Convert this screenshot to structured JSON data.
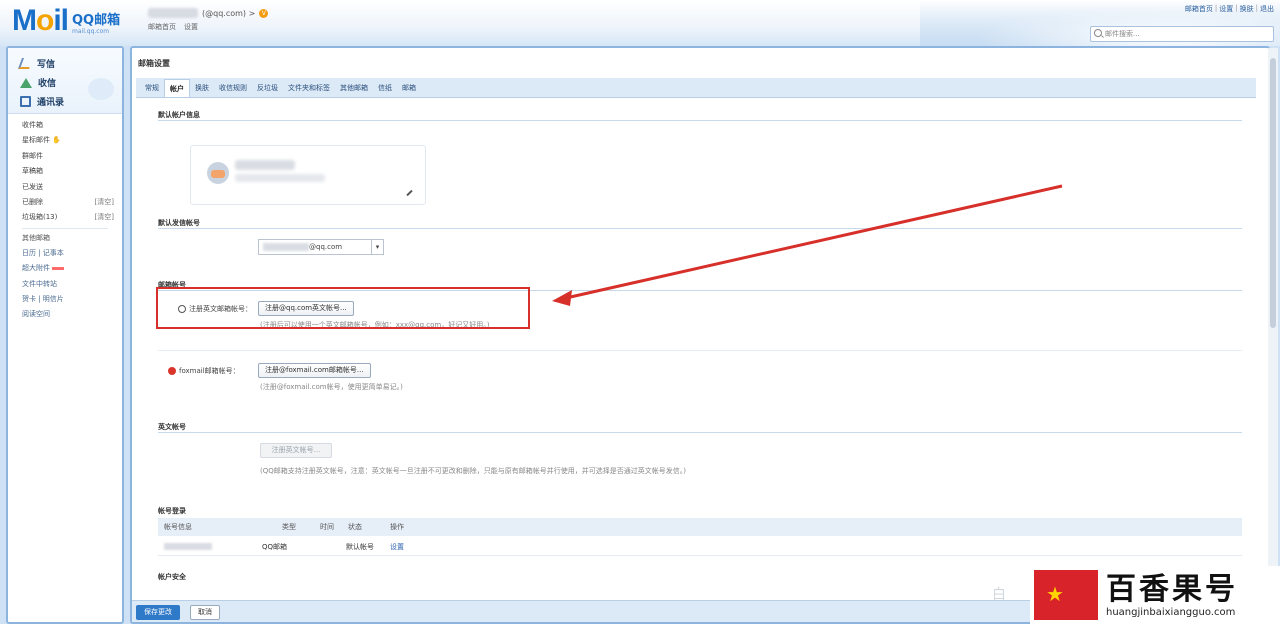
{
  "header": {
    "logo_main": "M",
    "logo_o": "o",
    "logo_tail": "il",
    "logo_cn": "QQ邮箱",
    "logo_sub": "mail.qq.com",
    "account_email": "(@qq.com) >",
    "vip": "V",
    "account_links": [
      "邮箱首页",
      "设置"
    ],
    "top_links": [
      "邮箱首页",
      "设置",
      "换肤",
      "退出"
    ],
    "search_placeholder": "邮件搜索..."
  },
  "sidebar": {
    "actions": [
      "写信",
      "收信",
      "通讯录"
    ],
    "folders": [
      {
        "label": "收件箱",
        "extra": ""
      },
      {
        "label": "星标邮件 ✋",
        "extra": ""
      },
      {
        "label": "群邮件",
        "extra": ""
      },
      {
        "label": "草稿箱",
        "extra": ""
      },
      {
        "label": "已发送",
        "extra": ""
      },
      {
        "label": "已删除",
        "extra": "[清空]"
      },
      {
        "label": "垃圾箱(13)",
        "extra": "[清空]"
      }
    ],
    "section_title": "其他邮箱",
    "subfolders": [
      "日历 | 记事本",
      "超大附件",
      "文件中转站",
      "贺卡 | 明信片",
      "阅读空间"
    ]
  },
  "panel": {
    "title": "邮箱设置",
    "tabs": [
      "常规",
      "帐户",
      "换肤",
      "收信规则",
      "反垃圾",
      "文件夹和标签",
      "其他邮箱",
      "信纸",
      "邮箱"
    ],
    "active_tab": "帐户",
    "sections": {
      "default_account": "默认帐户信息",
      "default_send": "默认发信帐号",
      "alias": "邮箱帐号",
      "english": "英文帐号",
      "login_history": "帐号登录",
      "security": "帐户安全"
    },
    "default_send_suffix": "@qq.com",
    "alias_qq_label": "注册英文邮箱帐号：",
    "alias_qq_button": "注册@qq.com英文帐号...",
    "alias_qq_hint": "(注册后可以使用一个英文邮箱帐号，例如：xxx@qq.com，好记又好用。)",
    "alias_foxmail_label": "foxmail邮箱帐号：",
    "alias_foxmail_button": "注册@foxmail.com邮箱帐号...",
    "alias_foxmail_hint": "(注册@foxmail.com帐号，使用更简单易记。)",
    "english_button": "注册英文帐号...",
    "english_hint": "(QQ邮箱支持注册英文帐号，注意：英文帐号一旦注册不可更改和删除，只能与原有邮箱帐号并行使用，并可选择是否通过英文帐号发信。)",
    "table_headers": [
      "帐号信息",
      "类型",
      "时间",
      "状态",
      "操作"
    ],
    "table_row": {
      "type": "QQ邮箱",
      "status": "默认帐号",
      "op": "设置"
    },
    "save_button": "保存更改",
    "cancel_button": "取消"
  },
  "watermark": {
    "title": "百香果号",
    "url": "huangjinbaixiangguo.com",
    "faint": "白"
  },
  "colors": {
    "accent": "#2f79c9",
    "highlight": "#d7302b"
  }
}
